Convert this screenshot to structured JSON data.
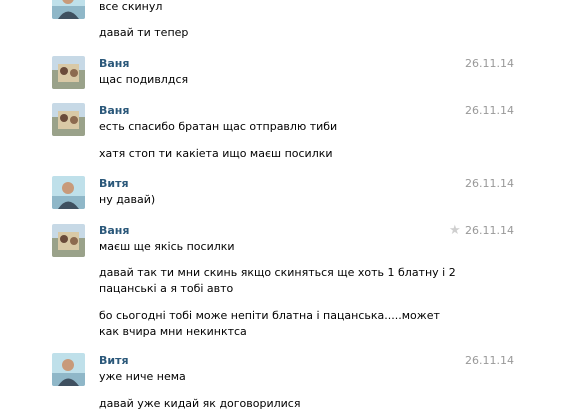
{
  "group0": {
    "messages": [
      "все скинул",
      "давай ти тепер"
    ]
  },
  "group1": {
    "author": "Ваня",
    "date": "26.11.14",
    "messages": [
      "щас подивлдся"
    ]
  },
  "group2": {
    "author": "Ваня",
    "date": "26.11.14",
    "messages": [
      "есть спасибо братан щас отправлю тиби",
      "хатя стоп ти какіета ищо маєш посилки"
    ]
  },
  "group3": {
    "author": "Витя",
    "date": "26.11.14",
    "messages": [
      "ну давай)"
    ]
  },
  "group4": {
    "author": "Ваня",
    "date": "26.11.14",
    "star_icon": "star-icon",
    "messages": [
      "маєш ще якісь посилки",
      "давай так ти мни скинь якщо скиняться ще хоть 1 блатну і 2 пацанські а я тобі авто",
      "бо сьогодні тобі може непіти блатна і пацанська.....может как вчира мни некинктса"
    ]
  },
  "group5": {
    "author": "Витя",
    "date": "26.11.14",
    "messages": [
      "уже ниче нема",
      "давай уже кидай як договорилися"
    ]
  },
  "colors": {
    "author_name": "#2b587a",
    "date": "#999999",
    "star": "#cfcfcf"
  }
}
